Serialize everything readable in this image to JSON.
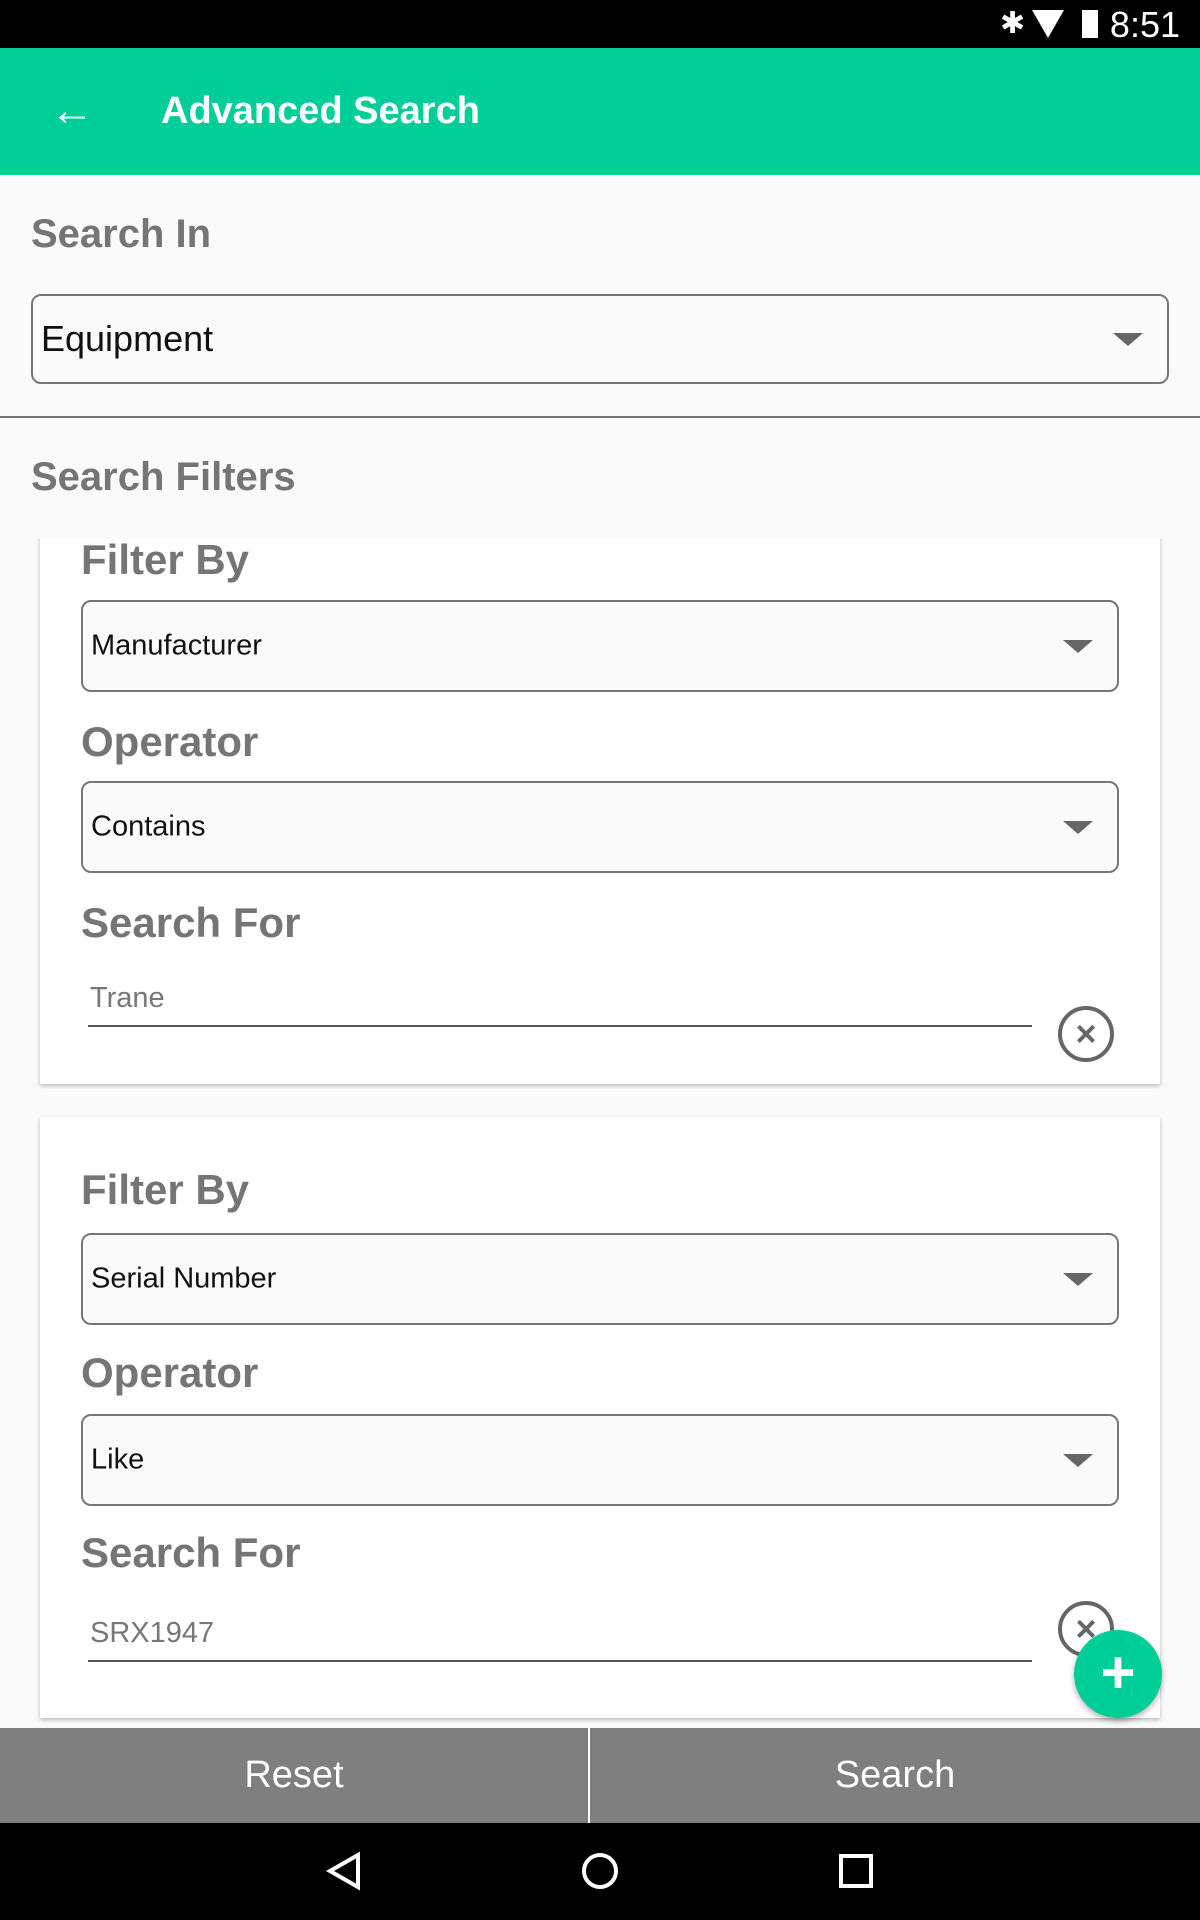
{
  "status_bar": {
    "time": "8:51"
  },
  "app_bar": {
    "title": "Advanced Search"
  },
  "search_in": {
    "label": "Search In",
    "value": "Equipment"
  },
  "search_filters": {
    "label": "Search Filters",
    "filters": [
      {
        "filter_by_label": "Filter By",
        "filter_by": "Manufacturer",
        "operator_label": "Operator",
        "operator": "Contains",
        "search_for_label": "Search For",
        "search_for": "Trane"
      },
      {
        "filter_by_label": "Filter By",
        "filter_by": "Serial Number",
        "operator_label": "Operator",
        "operator": "Like",
        "search_for_label": "Search For",
        "search_for": "SRX1947"
      }
    ]
  },
  "buttons": {
    "reset": "Reset",
    "search": "Search"
  },
  "colors": {
    "accent": "#00ce98",
    "label": "#757575",
    "bottom_bar": "#7f7f7f"
  }
}
